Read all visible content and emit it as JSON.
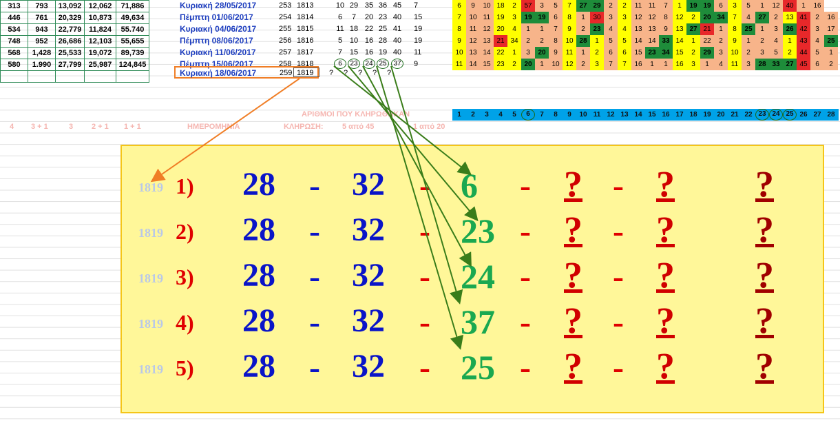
{
  "left_table": [
    [
      "313",
      "793",
      "13,092",
      "12,062",
      "71,886"
    ],
    [
      "446",
      "761",
      "20,329",
      "10,873",
      "49,634"
    ],
    [
      "534",
      "943",
      "22,779",
      "11,824",
      "55.740"
    ],
    [
      "748",
      "952",
      "26,686",
      "12,103",
      "55,655"
    ],
    [
      "568",
      "1,428",
      "25,533",
      "19,072",
      "89,739"
    ],
    [
      "580",
      "1.990",
      "27,799",
      "25,987",
      "124,845"
    ],
    [
      "",
      "",
      "",
      "",
      ""
    ]
  ],
  "draws": [
    {
      "date": "Κυριακή 28/05/2017",
      "a": "253",
      "b": "1813",
      "nums": [
        "10",
        "29",
        "35",
        "36",
        "45"
      ],
      "s": "7"
    },
    {
      "date": "Πέμπτη 01/06/2017",
      "a": "254",
      "b": "1814",
      "nums": [
        "6",
        "7",
        "20",
        "23",
        "40"
      ],
      "s": "15"
    },
    {
      "date": "Κυριακή 04/06/2017",
      "a": "255",
      "b": "1815",
      "nums": [
        "11",
        "18",
        "22",
        "25",
        "41"
      ],
      "s": "19"
    },
    {
      "date": "Πέμπτη 08/06/2017",
      "a": "256",
      "b": "1816",
      "nums": [
        "5",
        "10",
        "16",
        "28",
        "40"
      ],
      "s": "19"
    },
    {
      "date": "Κυριακή 11/06/2017",
      "a": "257",
      "b": "1817",
      "nums": [
        "7",
        "15",
        "16",
        "19",
        "40"
      ],
      "s": "11"
    },
    {
      "date": "Πέμπτη 15/06/2017",
      "a": "258",
      "b": "1818",
      "nums": [
        "6",
        "23",
        "24",
        "25",
        "37"
      ],
      "s": "9"
    }
  ],
  "highlight": {
    "date": "Κυριακή 18/06/2017",
    "a": "259",
    "b": "1819",
    "q": [
      "?",
      "?",
      "?",
      "?",
      "?"
    ]
  },
  "header_numbers": [
    "1",
    "2",
    "3",
    "4",
    "5",
    "6",
    "7",
    "8",
    "9",
    "10",
    "11",
    "12",
    "13",
    "14",
    "15",
    "16",
    "17",
    "18",
    "19",
    "20",
    "21",
    "22",
    "23",
    "24",
    "25",
    "26",
    "27",
    "28"
  ],
  "circled_header": [
    "6",
    "23",
    "24",
    "25"
  ],
  "faint_labels": {
    "cols": [
      "4",
      "3 + 1",
      "3",
      "2 + 1",
      "1 + 1"
    ],
    "date": "ΗΜΕΡΟΜΗΝΙΑ",
    "draw": "ΚΛΗΡΩΣΗ:",
    "fmt": "5 από 45",
    "title": "ΑΡΙΘΜΟΙ ΠΟΥ ΚΛΗΡΩΘΗΚΑΝ",
    "fmt2": "1 από 20"
  },
  "grid_rows": [
    [
      "6",
      "9",
      "10",
      "18",
      "2",
      "57",
      "3",
      "5",
      "7",
      "27",
      "29",
      "2",
      "2",
      "11",
      "11",
      "7",
      "1",
      "19",
      "19",
      "6",
      "3",
      "5",
      "1",
      "12",
      "40",
      "1",
      "16"
    ],
    [
      "7",
      "10",
      "11",
      "19",
      "3",
      "19",
      "19",
      "6",
      "8",
      "1",
      "30",
      "3",
      "3",
      "12",
      "12",
      "8",
      "12",
      "2",
      "20",
      "34",
      "7",
      "4",
      "27",
      "2",
      "13",
      "41",
      "2",
      "16"
    ],
    [
      "8",
      "11",
      "12",
      "20",
      "4",
      "1",
      "1",
      "7",
      "9",
      "2",
      "23",
      "4",
      "4",
      "13",
      "13",
      "9",
      "13",
      "27",
      "21",
      "1",
      "8",
      "25",
      "1",
      "3",
      "26",
      "42",
      "3",
      "17"
    ],
    [
      "9",
      "12",
      "13",
      "21",
      "34",
      "2",
      "2",
      "8",
      "10",
      "28",
      "1",
      "5",
      "5",
      "14",
      "14",
      "33",
      "14",
      "1",
      "22",
      "2",
      "9",
      "1",
      "2",
      "4",
      "1",
      "43",
      "4",
      "25"
    ],
    [
      "10",
      "13",
      "14",
      "22",
      "1",
      "3",
      "20",
      "9",
      "11",
      "1",
      "2",
      "6",
      "6",
      "15",
      "23",
      "34",
      "15",
      "2",
      "29",
      "3",
      "10",
      "2",
      "3",
      "5",
      "2",
      "44",
      "5",
      "1"
    ],
    [
      "11",
      "14",
      "15",
      "23",
      "2",
      "20",
      "1",
      "10",
      "12",
      "2",
      "3",
      "7",
      "7",
      "16",
      "1",
      "1",
      "16",
      "3",
      "1",
      "4",
      "11",
      "3",
      "28",
      "33",
      "27",
      "45",
      "6",
      "2"
    ]
  ],
  "big_lines": [
    {
      "idx": "1819",
      "no": "1)",
      "v1": "28",
      "v2": "32",
      "v3": "6",
      "q": "?"
    },
    {
      "idx": "1819",
      "no": "2)",
      "v1": "28",
      "v2": "32",
      "v3": "23",
      "q": "?"
    },
    {
      "idx": "1819",
      "no": "3)",
      "v1": "28",
      "v2": "32",
      "v3": "24",
      "q": "?"
    },
    {
      "idx": "1819",
      "no": "4)",
      "v1": "28",
      "v2": "32",
      "v3": "37",
      "q": "?"
    },
    {
      "idx": "1819",
      "no": "5)",
      "v1": "28",
      "v2": "32",
      "v3": "25",
      "q": "?"
    }
  ],
  "dash": "-",
  "colors": {
    "blue": "#0a14c8",
    "green": "#1aa850",
    "red": "#e00000",
    "yellow_panel": "#fff799",
    "header": "#00a2e8",
    "orange": "#f07e26"
  }
}
